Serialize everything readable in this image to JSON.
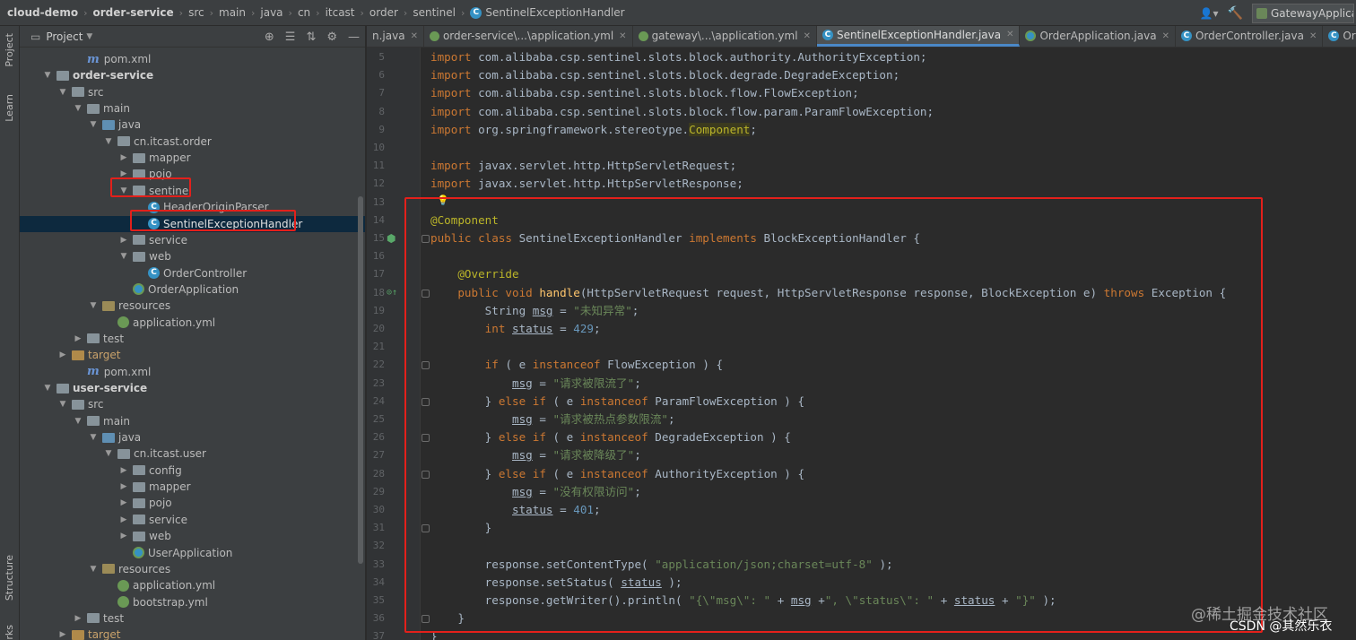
{
  "breadcrumb": [
    {
      "label": "cloud-demo",
      "bold": true
    },
    {
      "label": "order-service",
      "bold": true
    },
    {
      "label": "src"
    },
    {
      "label": "main"
    },
    {
      "label": "java"
    },
    {
      "label": "cn"
    },
    {
      "label": "itcast"
    },
    {
      "label": "order"
    },
    {
      "label": "sentinel"
    },
    {
      "label": "SentinelExceptionHandler",
      "icon": "class-icon"
    }
  ],
  "run_config": "GatewayApplication",
  "tool_stripe": {
    "project": "Project",
    "learn": "Learn",
    "structure": "Structure",
    "bookmarks": "rks"
  },
  "project_panel": {
    "title": "Project",
    "tree": [
      {
        "label": "pom.xml",
        "icon": "maven",
        "indent": 3,
        "arrow": ""
      },
      {
        "label": "order-service",
        "icon": "module",
        "indent": 1,
        "arrow": "open",
        "bold": true
      },
      {
        "label": "src",
        "icon": "folder",
        "indent": 2,
        "arrow": "open"
      },
      {
        "label": "main",
        "icon": "folder",
        "indent": 3,
        "arrow": "open"
      },
      {
        "label": "java",
        "icon": "src",
        "indent": 4,
        "arrow": "open"
      },
      {
        "label": "cn.itcast.order",
        "icon": "pkg",
        "indent": 5,
        "arrow": "open"
      },
      {
        "label": "mapper",
        "icon": "pkg",
        "indent": 6,
        "arrow": "closed"
      },
      {
        "label": "pojo",
        "icon": "pkg",
        "indent": 6,
        "arrow": "closed"
      },
      {
        "label": "sentinel",
        "icon": "pkg",
        "indent": 6,
        "arrow": "open"
      },
      {
        "label": "HeaderOriginParser",
        "icon": "class",
        "indent": 7,
        "arrow": ""
      },
      {
        "label": "SentinelExceptionHandler",
        "icon": "class",
        "indent": 7,
        "arrow": "",
        "selected": true
      },
      {
        "label": "service",
        "icon": "pkg",
        "indent": 6,
        "arrow": "closed"
      },
      {
        "label": "web",
        "icon": "pkg",
        "indent": 6,
        "arrow": "open"
      },
      {
        "label": "OrderController",
        "icon": "class",
        "indent": 7,
        "arrow": ""
      },
      {
        "label": "OrderApplication",
        "icon": "spring",
        "indent": 6,
        "arrow": ""
      },
      {
        "label": "resources",
        "icon": "res",
        "indent": 4,
        "arrow": "open"
      },
      {
        "label": "application.yml",
        "icon": "yml",
        "indent": 5,
        "arrow": ""
      },
      {
        "label": "test",
        "icon": "folder",
        "indent": 3,
        "arrow": "closed"
      },
      {
        "label": "target",
        "icon": "target",
        "indent": 2,
        "arrow": "closed"
      },
      {
        "label": "pom.xml",
        "icon": "maven",
        "indent": 3,
        "arrow": ""
      },
      {
        "label": "user-service",
        "icon": "module",
        "indent": 1,
        "arrow": "open",
        "bold": true
      },
      {
        "label": "src",
        "icon": "folder",
        "indent": 2,
        "arrow": "open"
      },
      {
        "label": "main",
        "icon": "folder",
        "indent": 3,
        "arrow": "open"
      },
      {
        "label": "java",
        "icon": "src",
        "indent": 4,
        "arrow": "open"
      },
      {
        "label": "cn.itcast.user",
        "icon": "pkg",
        "indent": 5,
        "arrow": "open"
      },
      {
        "label": "config",
        "icon": "pkg",
        "indent": 6,
        "arrow": "closed"
      },
      {
        "label": "mapper",
        "icon": "pkg",
        "indent": 6,
        "arrow": "closed"
      },
      {
        "label": "pojo",
        "icon": "pkg",
        "indent": 6,
        "arrow": "closed"
      },
      {
        "label": "service",
        "icon": "pkg",
        "indent": 6,
        "arrow": "closed"
      },
      {
        "label": "web",
        "icon": "pkg",
        "indent": 6,
        "arrow": "closed"
      },
      {
        "label": "UserApplication",
        "icon": "spring",
        "indent": 6,
        "arrow": ""
      },
      {
        "label": "resources",
        "icon": "res",
        "indent": 4,
        "arrow": "open"
      },
      {
        "label": "application.yml",
        "icon": "yml",
        "indent": 5,
        "arrow": ""
      },
      {
        "label": "bootstrap.yml",
        "icon": "yml",
        "indent": 5,
        "arrow": ""
      },
      {
        "label": "test",
        "icon": "folder",
        "indent": 3,
        "arrow": "closed"
      },
      {
        "label": "target",
        "icon": "target",
        "indent": 2,
        "arrow": "closed"
      }
    ]
  },
  "editor_tabs": [
    {
      "label": "n.java",
      "icon": "none"
    },
    {
      "label": "order-service\\...\\application.yml",
      "icon": "yml"
    },
    {
      "label": "gateway\\...\\application.yml",
      "icon": "yml"
    },
    {
      "label": "SentinelExceptionHandler.java",
      "icon": "class",
      "active": true
    },
    {
      "label": "OrderApplication.java",
      "icon": "spring"
    },
    {
      "label": "OrderController.java",
      "icon": "class"
    },
    {
      "label": "OrderService.java",
      "icon": "class"
    }
  ],
  "code_lines": [
    {
      "n": "5",
      "t": [
        [
          "kw",
          "import "
        ],
        [
          "p",
          "com.alibaba.csp.sentinel.slots.block.authority.AuthorityException;"
        ]
      ]
    },
    {
      "n": "6",
      "t": [
        [
          "kw",
          "import "
        ],
        [
          "p",
          "com.alibaba.csp.sentinel.slots.block.degrade.DegradeException;"
        ]
      ]
    },
    {
      "n": "7",
      "t": [
        [
          "kw",
          "import "
        ],
        [
          "p",
          "com.alibaba.csp.sentinel.slots.block.flow.FlowException;"
        ]
      ]
    },
    {
      "n": "8",
      "t": [
        [
          "kw",
          "import "
        ],
        [
          "p",
          "com.alibaba.csp.sentinel.slots.block.flow.param.ParamFlowException;"
        ]
      ]
    },
    {
      "n": "9",
      "t": [
        [
          "kw",
          "import "
        ],
        [
          "p",
          "org.springframework.stereotype."
        ],
        [
          "cmp",
          "Component"
        ],
        [
          "p",
          ";"
        ]
      ]
    },
    {
      "n": "10",
      "t": []
    },
    {
      "n": "11",
      "t": [
        [
          "kw",
          "import "
        ],
        [
          "p",
          "javax.servlet.http.HttpServletRequest;"
        ]
      ]
    },
    {
      "n": "12",
      "t": [
        [
          "kw",
          "import "
        ],
        [
          "p",
          "javax.servlet.http.HttpServletResponse;"
        ]
      ]
    },
    {
      "n": "13",
      "t": []
    },
    {
      "n": "14",
      "t": [
        [
          "ann",
          "@Component"
        ]
      ]
    },
    {
      "n": "15",
      "t": [
        [
          "kw",
          "public class "
        ],
        [
          "p",
          "SentinelExceptionHandler "
        ],
        [
          "kw",
          "implements "
        ],
        [
          "p",
          "BlockExceptionHandler {"
        ]
      ]
    },
    {
      "n": "16",
      "t": []
    },
    {
      "n": "17",
      "t": [
        [
          "p",
          "    "
        ],
        [
          "ann",
          "@Override"
        ]
      ]
    },
    {
      "n": "18",
      "t": [
        [
          "p",
          "    "
        ],
        [
          "kw",
          "public void "
        ],
        [
          "fn",
          "handle"
        ],
        [
          "p",
          "(HttpServletRequest request, HttpServletResponse response, BlockException e) "
        ],
        [
          "kw",
          "throws "
        ],
        [
          "p",
          "Exception {"
        ]
      ]
    },
    {
      "n": "19",
      "t": [
        [
          "p",
          "        String "
        ],
        [
          "fld",
          "msg"
        ],
        [
          "p",
          " = "
        ],
        [
          "str",
          "\"未知异常\""
        ],
        [
          "p",
          ";"
        ]
      ]
    },
    {
      "n": "20",
      "t": [
        [
          "p",
          "        "
        ],
        [
          "kw",
          "int "
        ],
        [
          "fld",
          "status"
        ],
        [
          "p",
          " = "
        ],
        [
          "num",
          "429"
        ],
        [
          "p",
          ";"
        ]
      ]
    },
    {
      "n": "21",
      "t": []
    },
    {
      "n": "22",
      "t": [
        [
          "p",
          "        "
        ],
        [
          "kw",
          "if "
        ],
        [
          "p",
          "( e "
        ],
        [
          "kw",
          "instanceof "
        ],
        [
          "p",
          "FlowException ) {"
        ]
      ]
    },
    {
      "n": "23",
      "t": [
        [
          "p",
          "            "
        ],
        [
          "fld",
          "msg"
        ],
        [
          "p",
          " = "
        ],
        [
          "str",
          "\"请求被限流了\""
        ],
        [
          "p",
          ";"
        ]
      ]
    },
    {
      "n": "24",
      "t": [
        [
          "p",
          "        } "
        ],
        [
          "kw",
          "else if "
        ],
        [
          "p",
          "( e "
        ],
        [
          "kw",
          "instanceof "
        ],
        [
          "p",
          "ParamFlowException ) {"
        ]
      ]
    },
    {
      "n": "25",
      "t": [
        [
          "p",
          "            "
        ],
        [
          "fld",
          "msg"
        ],
        [
          "p",
          " = "
        ],
        [
          "str",
          "\"请求被热点参数限流\""
        ],
        [
          "p",
          ";"
        ]
      ]
    },
    {
      "n": "26",
      "t": [
        [
          "p",
          "        } "
        ],
        [
          "kw",
          "else if "
        ],
        [
          "p",
          "( e "
        ],
        [
          "kw",
          "instanceof "
        ],
        [
          "p",
          "DegradeException ) {"
        ]
      ]
    },
    {
      "n": "27",
      "t": [
        [
          "p",
          "            "
        ],
        [
          "fld",
          "msg"
        ],
        [
          "p",
          " = "
        ],
        [
          "str",
          "\"请求被降级了\""
        ],
        [
          "p",
          ";"
        ]
      ]
    },
    {
      "n": "28",
      "t": [
        [
          "p",
          "        } "
        ],
        [
          "kw",
          "else if "
        ],
        [
          "p",
          "( e "
        ],
        [
          "kw",
          "instanceof "
        ],
        [
          "p",
          "AuthorityException ) {"
        ]
      ]
    },
    {
      "n": "29",
      "t": [
        [
          "p",
          "            "
        ],
        [
          "fld",
          "msg"
        ],
        [
          "p",
          " = "
        ],
        [
          "str",
          "\"没有权限访问\""
        ],
        [
          "p",
          ";"
        ]
      ]
    },
    {
      "n": "30",
      "t": [
        [
          "p",
          "            "
        ],
        [
          "fld",
          "status"
        ],
        [
          "p",
          " = "
        ],
        [
          "num",
          "401"
        ],
        [
          "p",
          ";"
        ]
      ]
    },
    {
      "n": "31",
      "t": [
        [
          "p",
          "        }"
        ]
      ]
    },
    {
      "n": "32",
      "t": []
    },
    {
      "n": "33",
      "t": [
        [
          "p",
          "        response.setContentType( "
        ],
        [
          "str",
          "\"application/json;charset=utf-8\""
        ],
        [
          "p",
          " );"
        ]
      ]
    },
    {
      "n": "34",
      "t": [
        [
          "p",
          "        response.setStatus( "
        ],
        [
          "fld",
          "status"
        ],
        [
          "p",
          " );"
        ]
      ]
    },
    {
      "n": "35",
      "t": [
        [
          "p",
          "        response.getWriter().println( "
        ],
        [
          "str",
          "\"{\\\"msg\\\": \""
        ],
        [
          "p",
          " + "
        ],
        [
          "fld",
          "msg"
        ],
        [
          "p",
          " +"
        ],
        [
          "str",
          "\", \\\"status\\\": \""
        ],
        [
          "p",
          " + "
        ],
        [
          "fld",
          "status"
        ],
        [
          "p",
          " + "
        ],
        [
          "str",
          "\"}\""
        ],
        [
          "p",
          " );"
        ]
      ]
    },
    {
      "n": "36",
      "t": [
        [
          "p",
          "    }"
        ]
      ]
    },
    {
      "n": "37",
      "t": [
        [
          "p",
          "}"
        ]
      ]
    }
  ],
  "watermark": {
    "line1": "@稀土掘金技术社区",
    "line2": "CSDN @其然乐衣"
  },
  "colors": {
    "highlight_box": "#e3201b",
    "selection": "#0d293e",
    "accent": "#4a88c7"
  }
}
